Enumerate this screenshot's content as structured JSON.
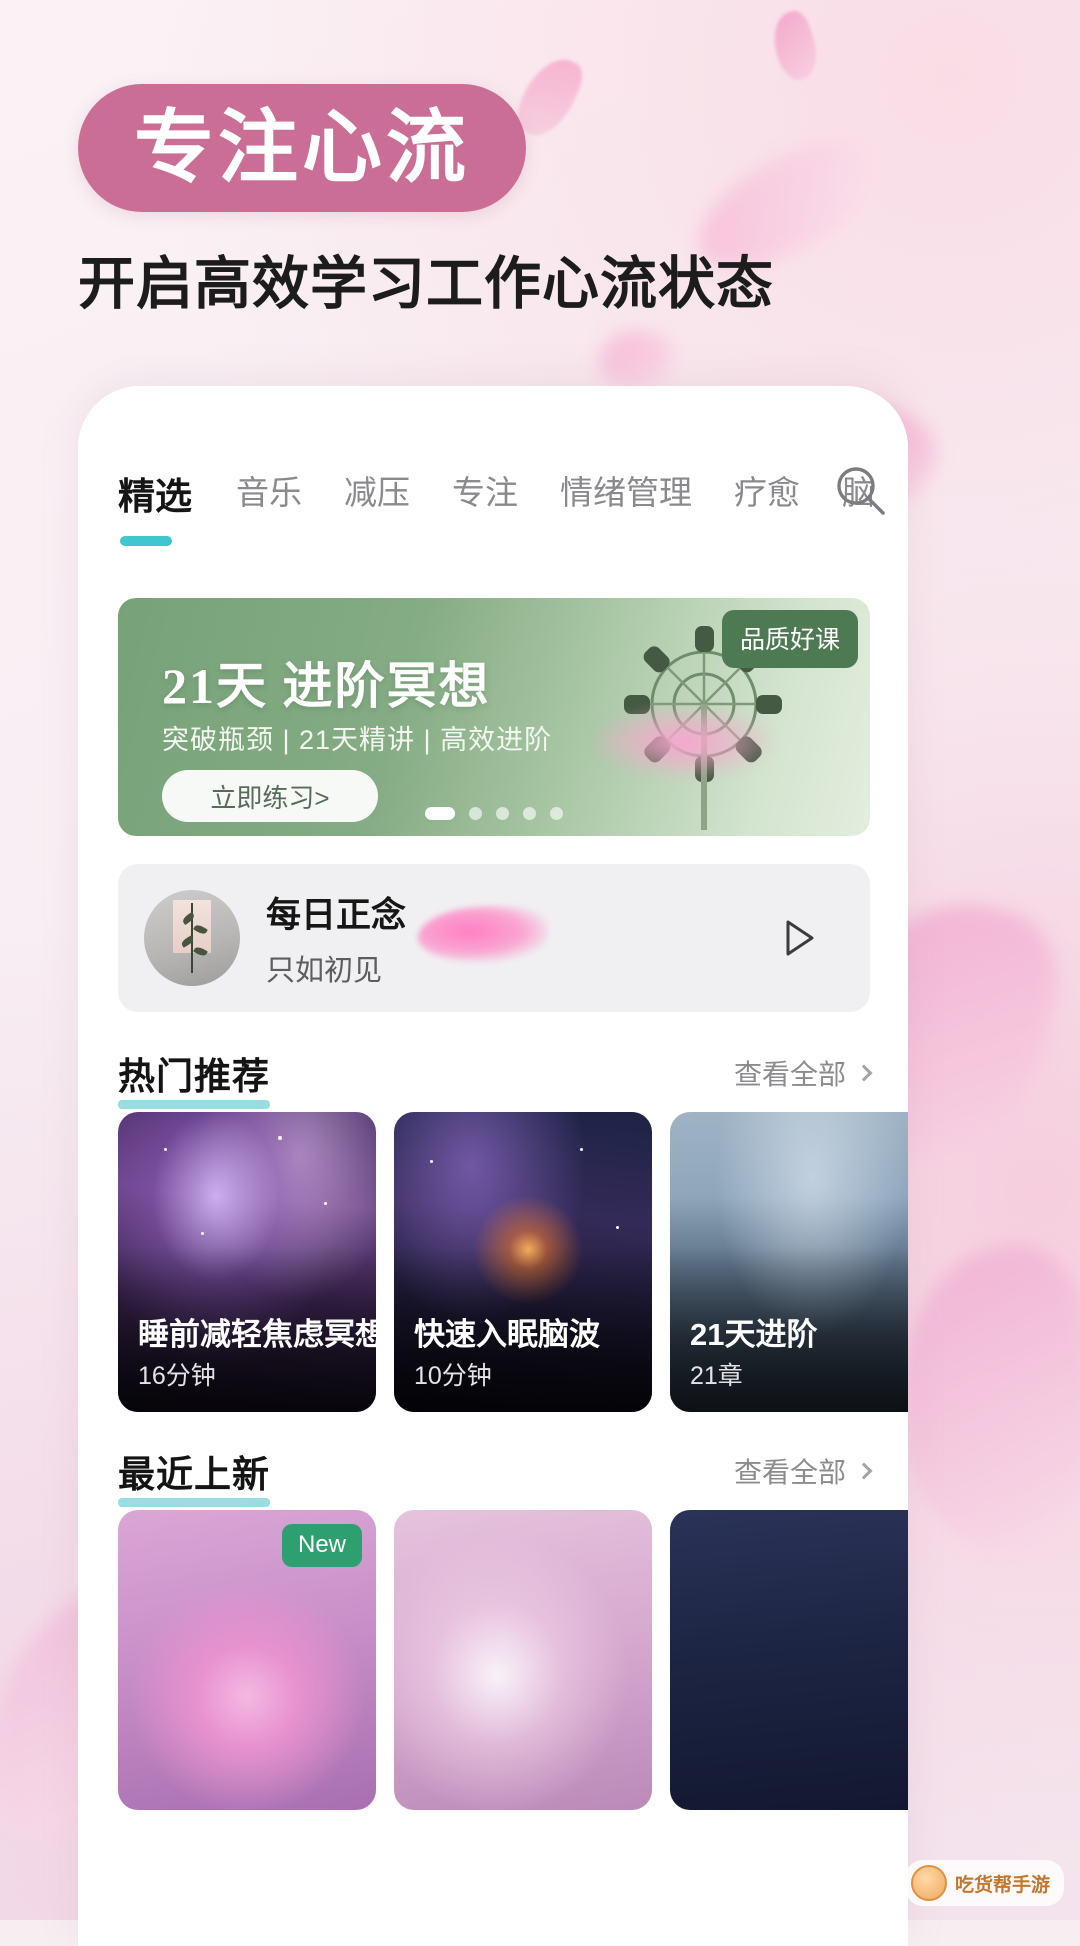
{
  "promo": {
    "pill_text": "专注心流",
    "subheadline": "开启高效学习工作心流状态",
    "pill_color": "#cb6e96",
    "background_color": "#f7eef2"
  },
  "app": {
    "tabs": [
      {
        "label": "精选",
        "active": true
      },
      {
        "label": "音乐",
        "active": false
      },
      {
        "label": "减压",
        "active": false
      },
      {
        "label": "专注",
        "active": false
      },
      {
        "label": "情绪管理",
        "active": false
      },
      {
        "label": "疗愈",
        "active": false
      },
      {
        "label": "脑",
        "active": false
      }
    ],
    "search_icon": "search-icon",
    "accent_color": "#3fc6cf",
    "banner": {
      "badge": "品质好课",
      "title": "21天 进阶冥想",
      "subtitle": "突破瓶颈 | 21天精讲 | 高效进阶",
      "button": "立即练习>",
      "dots_total": 5,
      "dots_active_index": 0,
      "bg_color": "#77a278"
    },
    "daily": {
      "title": "每日正念",
      "subtitle": "只如初见",
      "play_icon": "play-icon"
    },
    "sections": [
      {
        "title": "热门推荐",
        "more_label": "查看全部",
        "more_icon": "chevron-right-icon",
        "cards": [
          {
            "title": "睡前减轻焦虑冥想",
            "meta": "16分钟",
            "art": "art-galaxy1",
            "badge": ""
          },
          {
            "title": "快速入眠脑波",
            "meta": "10分钟",
            "art": "art-galaxy2",
            "badge": ""
          },
          {
            "title": "21天进阶",
            "meta": "21章",
            "art": "art-lake",
            "badge": ""
          }
        ]
      },
      {
        "title": "最近上新",
        "more_label": "查看全部",
        "more_icon": "chevron-right-icon",
        "cards": [
          {
            "title": "",
            "meta": "",
            "art": "art-pinkorb",
            "badge": "New"
          },
          {
            "title": "",
            "meta": "",
            "art": "art-clouds",
            "badge": ""
          },
          {
            "title": "",
            "meta": "",
            "art": "art-night",
            "badge": ""
          }
        ]
      }
    ]
  },
  "watermark": {
    "text": "吃货帮手游"
  }
}
